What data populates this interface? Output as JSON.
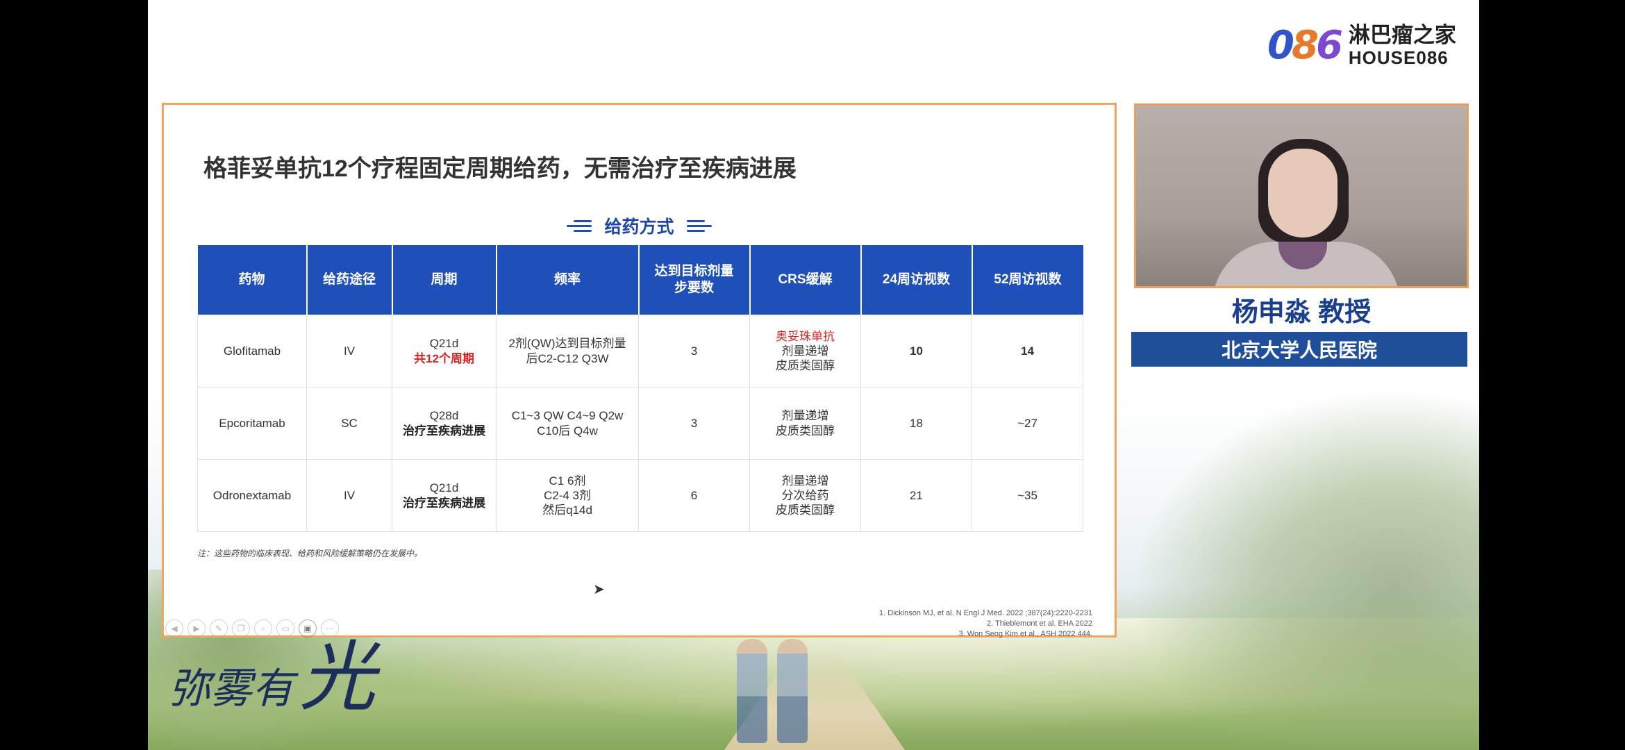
{
  "logo": {
    "mark": "086",
    "name_cn": "淋巴瘤之家",
    "name_en": "HOUSE086"
  },
  "slide": {
    "title": "格菲妥单抗12个疗程固定周期给药，无需治疗至疾病进展",
    "section_label": "给药方式",
    "table": {
      "headers": [
        "药物",
        "给药途径",
        "周期",
        "频率",
        "达到目标剂量步要数",
        "CRS缓解",
        "24周访视数",
        "52周访视数"
      ],
      "headers_split": {
        "steps_line1": "达到目标剂量",
        "steps_line2": "步要数"
      },
      "rows": [
        {
          "drug": "Glofitamab",
          "route": "IV",
          "cycle_line1": "Q21d",
          "cycle_line2": "共12个周期",
          "freq_line1": "2剂(QW)达到目标剂量",
          "freq_line2": "后C2-C12 Q3W",
          "freq_line3": "",
          "steps": "3",
          "crs_line1": "奥妥珠单抗",
          "crs_line2": "剂量递增",
          "crs_line3": "皮质类固醇",
          "visits24": "10",
          "visits52": "14"
        },
        {
          "drug": "Epcoritamab",
          "route": "SC",
          "cycle_line1": "Q28d",
          "cycle_line2": "治疗至疾病进展",
          "freq_line1": "C1~3 QW C4~9 Q2w",
          "freq_line2": "C10后 Q4w",
          "freq_line3": "",
          "steps": "3",
          "crs_line1": "",
          "crs_line2": "剂量递增",
          "crs_line3": "皮质类固醇",
          "visits24": "18",
          "visits52": "~27"
        },
        {
          "drug": "Odronextamab",
          "route": "IV",
          "cycle_line1": "Q21d",
          "cycle_line2": "治疗至疾病进展",
          "freq_line1": "C1 6剂",
          "freq_line2": "C2-4 3剂",
          "freq_line3": "然后q14d",
          "steps": "6",
          "crs_line1": "剂量递增",
          "crs_line2": "分次给药",
          "crs_line3": "皮质类固醇",
          "visits24": "21",
          "visits52": "~35"
        }
      ]
    },
    "footnote": "注：这些药物的临床表现、给药和风险缓解策略仍在发展中。",
    "references": [
      "1.   Dickinson MJ, et al. N Engl J Med. 2022 ;387(24):2220-2231",
      "2.   Thieblemont et al. EHA 2022",
      "3.   Won Seog Kim et al., ASH 2022 444."
    ],
    "toolbar_icons": [
      "prev-icon",
      "next-icon",
      "pen-icon",
      "copy-icon",
      "zoom-icon",
      "screen-icon",
      "camera-icon",
      "more-icon"
    ]
  },
  "speaker": {
    "name": "杨申淼 教授",
    "hospital": "北京大学人民医院"
  },
  "branding": {
    "slogan_main": "弥雾有",
    "slogan_big": "光"
  },
  "colors": {
    "table_header": "#1f4fb8",
    "accent_red": "#d62424",
    "slide_border": "#f1a55e",
    "speaker_name": "#1b3f8f",
    "hospital_bar": "#1f4e9a"
  }
}
